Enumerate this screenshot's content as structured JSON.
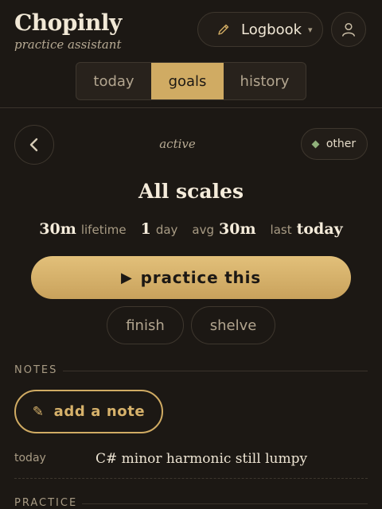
{
  "app": {
    "name": "Chopinly",
    "subtitle": "practice assistant"
  },
  "header": {
    "logbook_label": "Logbook",
    "logbook_icon": "pencil-icon",
    "caret": "▾",
    "user_icon": "user-icon"
  },
  "tabs": [
    {
      "label": "today",
      "active": false
    },
    {
      "label": "goals",
      "active": true
    },
    {
      "label": "history",
      "active": false
    }
  ],
  "goal": {
    "status": "active",
    "category": "other",
    "category_color": "#8fb07a",
    "title": "All scales",
    "stats": [
      {
        "prefix": "",
        "value": "30m",
        "suffix": "lifetime"
      },
      {
        "prefix": "",
        "value": "1",
        "suffix": "day"
      },
      {
        "prefix": "avg",
        "value": "30m",
        "suffix": ""
      },
      {
        "prefix": "last",
        "value": "today",
        "suffix": ""
      }
    ]
  },
  "actions": {
    "practice_label": "practice this",
    "play_glyph": "▶",
    "finish_label": "finish",
    "shelve_label": "shelve"
  },
  "notes": {
    "section_label": "NOTES",
    "add_label": "add a note",
    "add_glyph": "✎",
    "items": [
      {
        "date": "today",
        "text": "C# minor harmonic still lumpy"
      }
    ]
  },
  "practice": {
    "section_label": "PRACTICE"
  },
  "colors": {
    "accent": "#d0ab63",
    "background": "#1c1814",
    "text": "#ede4d3",
    "muted": "#a89b84"
  }
}
